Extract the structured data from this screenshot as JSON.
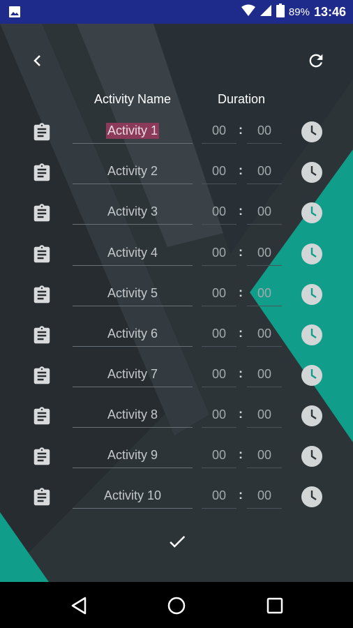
{
  "status_bar": {
    "battery": "89%",
    "time": "13:46"
  },
  "header": {
    "activity_name": "Activity Name",
    "duration": "Duration"
  },
  "colon": ":",
  "rows": [
    {
      "name": "Activity 1",
      "hours": "00",
      "minutes": "00"
    },
    {
      "name": "Activity 2",
      "hours": "00",
      "minutes": "00"
    },
    {
      "name": "Activity 3",
      "hours": "00",
      "minutes": "00"
    },
    {
      "name": "Activity 4",
      "hours": "00",
      "minutes": "00"
    },
    {
      "name": "Activity 5",
      "hours": "00",
      "minutes": "00"
    },
    {
      "name": "Activity 6",
      "hours": "00",
      "minutes": "00"
    },
    {
      "name": "Activity 7",
      "hours": "00",
      "minutes": "00"
    },
    {
      "name": "Activity 8",
      "hours": "00",
      "minutes": "00"
    },
    {
      "name": "Activity 9",
      "hours": "00",
      "minutes": "00"
    },
    {
      "name": "Activity 10",
      "hours": "00",
      "minutes": "00"
    }
  ],
  "colors": {
    "status_bar": "#1f2b8a",
    "background": "#2d3438",
    "accent_teal": "#109e8a",
    "selection": "#8c3a5a"
  },
  "icons": {
    "status_left": "gallery-icon",
    "status_right": [
      "wifi-icon",
      "signal-icon",
      "battery-icon"
    ],
    "top_left": "back-arrow-icon",
    "top_right": "refresh-icon",
    "row_left": "clipboard-icon",
    "row_right": "clock-icon",
    "bottom": "checkmark-icon",
    "nav": [
      "nav-back-icon",
      "nav-home-icon",
      "nav-recent-icon"
    ]
  }
}
